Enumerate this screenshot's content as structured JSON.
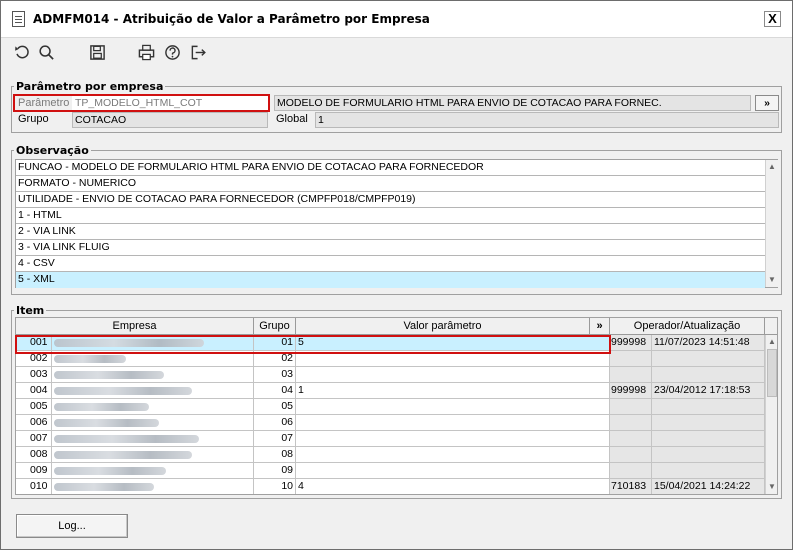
{
  "window": {
    "title": "ADMFM014 - Atribuição de Valor a Parâmetro por Empresa",
    "close_label": "X"
  },
  "toolbar": {
    "icons": [
      "refresh-icon",
      "search-icon",
      "save-icon",
      "print-icon",
      "help-icon",
      "exit-icon"
    ]
  },
  "parametro_section": {
    "legend": "Parâmetro por empresa",
    "parametro_label": "Parâmetro",
    "parametro_value": "TP_MODELO_HTML_COT",
    "descricao_value": "MODELO DE FORMULARIO HTML PARA ENVIO DE COTACAO PARA FORNEC.",
    "expand_label": "»",
    "grupo_label": "Grupo",
    "grupo_value": "COTACAO",
    "global_label": "Global",
    "global_value": "1"
  },
  "observacao_section": {
    "legend": "Observação",
    "lines": [
      "FUNCAO - MODELO DE FORMULARIO HTML PARA ENVIO DE COTACAO PARA FORNECEDOR",
      "FORMATO - NUMERICO",
      "UTILIDADE - ENVIO DE COTACAO PARA FORNECEDOR (CMPFP018/CMPFP019)",
      "1 - HTML",
      "2 - VIA LINK",
      "3 - VIA LINK FLUIG",
      "4 - CSV",
      "5 - XML"
    ],
    "selected_index": 7
  },
  "item_section": {
    "legend": "Item",
    "columns": {
      "empresa": "Empresa",
      "grupo": "Grupo",
      "valor": "Valor parâmetro",
      "expand": "»",
      "operador": "Operador/Atualização"
    },
    "rows": [
      {
        "codigo": "001",
        "grupo": "01",
        "valor": "5",
        "operador": "999998",
        "data": "11/07/2023 14:51:48",
        "selected": true
      },
      {
        "codigo": "002",
        "grupo": "02",
        "valor": "",
        "operador": "",
        "data": ""
      },
      {
        "codigo": "003",
        "grupo": "03",
        "valor": "",
        "operador": "",
        "data": ""
      },
      {
        "codigo": "004",
        "grupo": "04",
        "valor": "1",
        "operador": "999998",
        "data": "23/04/2012 17:18:53"
      },
      {
        "codigo": "005",
        "grupo": "05",
        "valor": "",
        "operador": "",
        "data": ""
      },
      {
        "codigo": "006",
        "grupo": "06",
        "valor": "",
        "operador": "",
        "data": ""
      },
      {
        "codigo": "007",
        "grupo": "07",
        "valor": "",
        "operador": "",
        "data": ""
      },
      {
        "codigo": "008",
        "grupo": "08",
        "valor": "",
        "operador": "",
        "data": ""
      },
      {
        "codigo": "009",
        "grupo": "09",
        "valor": "",
        "operador": "",
        "data": ""
      },
      {
        "codigo": "010",
        "grupo": "10",
        "valor": "4",
        "operador": "710183",
        "data": "15/04/2021 14:24:22"
      }
    ]
  },
  "footer": {
    "log_button": "Log..."
  },
  "colors": {
    "selection": "#c9f0ff",
    "highlight_box": "#d01010"
  }
}
